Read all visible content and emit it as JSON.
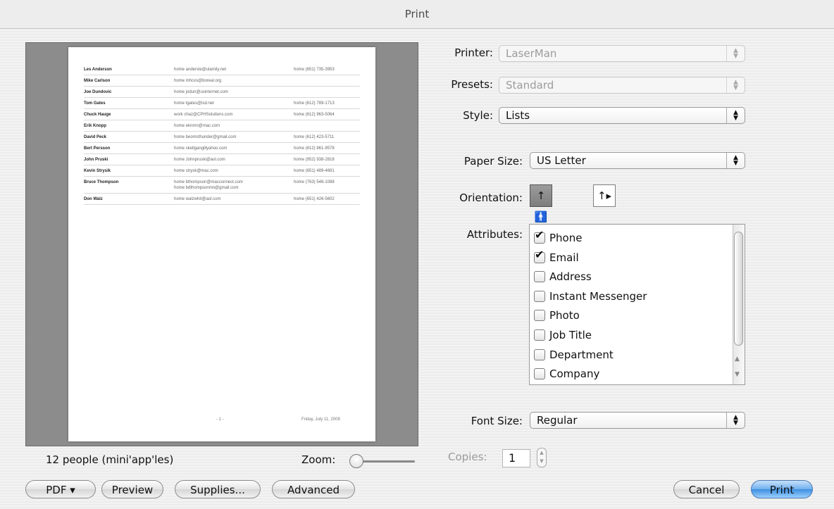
{
  "window": {
    "title": "Print"
  },
  "preview": {
    "contacts": [
      {
        "name": "Les Anderson",
        "email1": "home andersle@ulamily.net",
        "email2": "",
        "phone": "home (651) 735-3953"
      },
      {
        "name": "Mike Carlson",
        "email1": "home mhcvs@boreal.org",
        "email2": "",
        "phone": ""
      },
      {
        "name": "Joe Dundovic",
        "email1": "home jodun@usinternet.com",
        "email2": "",
        "phone": ""
      },
      {
        "name": "Tom Gates",
        "email1": "home tgates@isd.net",
        "email2": "",
        "phone": "home (612) 789-1713"
      },
      {
        "name": "Chuck Hauge",
        "email1": "work chaz@CPHSolutions.com",
        "email2": "",
        "phone": "home (612) 963-5064"
      },
      {
        "name": "Erik Knopp",
        "email1": "home eknmn@mac.com",
        "email2": "",
        "phone": ""
      },
      {
        "name": "David Peck",
        "email1": "home beomsthunder@gmail.com",
        "email2": "",
        "phone": "home (612) 423-5711"
      },
      {
        "name": "Bert Persson",
        "email1": "home skellgangillyahoo.com",
        "email2": "",
        "phone": "home (612) 861-9578"
      },
      {
        "name": "John Pruski",
        "email1": "home Johnpruski@aol.com",
        "email2": "",
        "phone": "home (952) 938-2818"
      },
      {
        "name": "Kevin Strysik",
        "email1": "home strysk@mac.com",
        "email2": "",
        "phone": "home (651) 489-4691"
      },
      {
        "name": "Bruce Thompson",
        "email1": "home bthompson@macconnect.com",
        "email2": "home bdthompsonmn@gmail.com",
        "phone": "home (763) 546-1088"
      },
      {
        "name": "Don Walz",
        "email1": "home walzwhit@aol.com",
        "email2": "",
        "phone": "home (651) 426-5602"
      }
    ],
    "page_number": "- 1 -",
    "date": "Friday, July 11, 2008"
  },
  "status": {
    "people_count": "12 people (mini'app'les)",
    "zoom_label": "Zoom:"
  },
  "buttons": {
    "pdf": "PDF ▾",
    "preview": "Preview",
    "supplies": "Supplies...",
    "advanced": "Advanced",
    "cancel": "Cancel",
    "print": "Print"
  },
  "settings": {
    "printer_label": "Printer:",
    "printer_value": "LaserMan",
    "presets_label": "Presets:",
    "presets_value": "Standard",
    "style_label": "Style:",
    "style_value": "Lists",
    "paper_size_label": "Paper Size:",
    "paper_size_value": "US Letter",
    "orientation_label": "Orientation:",
    "attributes_label": "Attributes:",
    "font_size_label": "Font Size:",
    "font_size_value": "Regular",
    "copies_label": "Copies:",
    "copies_value": "1"
  },
  "attributes": [
    {
      "label": "Phone",
      "checked": true
    },
    {
      "label": "Email",
      "checked": true
    },
    {
      "label": "Address",
      "checked": false
    },
    {
      "label": "Instant Messenger",
      "checked": false
    },
    {
      "label": "Photo",
      "checked": false
    },
    {
      "label": "Job Title",
      "checked": false
    },
    {
      "label": "Department",
      "checked": false
    },
    {
      "label": "Company",
      "checked": false
    }
  ],
  "icons": {
    "checkmark": "✔",
    "popup_arrows": "▲▼",
    "orientation_portrait": "portrait-person-icon",
    "orientation_landscape": "landscape-person-icon"
  },
  "colors": {
    "default_button": "#3d8fe0",
    "preview_background": "#8c8c8c"
  }
}
